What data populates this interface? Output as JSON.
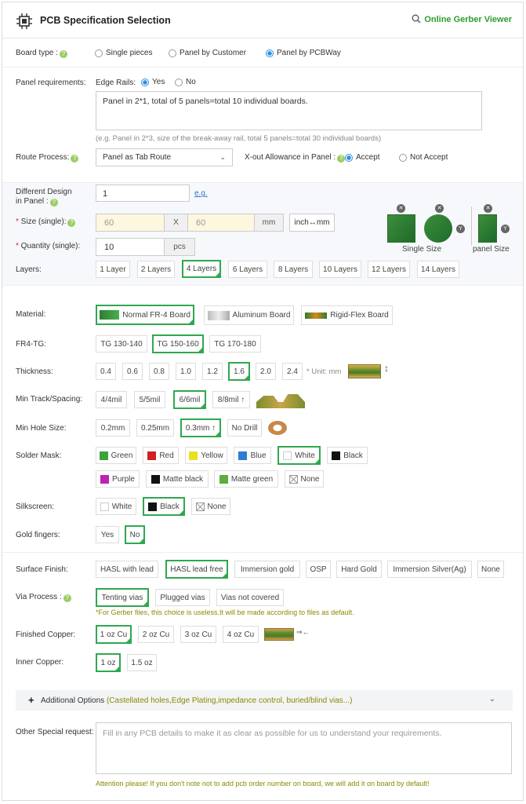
{
  "header": {
    "title": "PCB Specification Selection",
    "gerber_link": "Online Gerber Viewer"
  },
  "board_type": {
    "label": "Board type :",
    "options": [
      "Single pieces",
      "Panel by Customer",
      "Panel by PCBWay"
    ],
    "selected": "Panel by PCBWay"
  },
  "panel": {
    "label": "Panel requirements:",
    "edge_rails_label": "Edge Rails:",
    "edge_yes": "Yes",
    "edge_no": "No",
    "edge_selected": "Yes",
    "text": "Panel in 2*1, total of 5 panels=total 10 individual boards.",
    "hint": "(e.g. Panel in 2*3, size of the break-away rail, total 5 panels=total 30 individual boards)"
  },
  "route": {
    "label": "Route Process:",
    "value": "Panel as Tab Route",
    "xout_label": "X-out Allowance in Panel :",
    "accept": "Accept",
    "not_accept": "Not Accept",
    "selected": "Accept"
  },
  "different_design": {
    "label1": "Different Design",
    "label2": "in Panel :",
    "value": "1",
    "eg": "e.g."
  },
  "size": {
    "label": "Size (single):",
    "w_placeholder": "60",
    "x": "X",
    "h_placeholder": "60",
    "unit": "mm",
    "convert": "inch↔mm",
    "single_caption": "Single Size",
    "panel_caption": "panel Size"
  },
  "quantity": {
    "label": "Quantity (single):",
    "value": "10",
    "unit": "pcs"
  },
  "layers": {
    "label": "Layers:",
    "options": [
      "1 Layer",
      "2 Layers",
      "4 Layers",
      "6 Layers",
      "8 Layers",
      "10 Layers",
      "12 Layers",
      "14 Layers"
    ],
    "selected": "4 Layers"
  },
  "material": {
    "label": "Material:",
    "options": [
      "Normal FR-4 Board",
      "Aluminum Board",
      "Rigid-Flex Board"
    ],
    "selected": "Normal FR-4 Board"
  },
  "fr4tg": {
    "label": "FR4-TG:",
    "options": [
      "TG 130-140",
      "TG 150-160",
      "TG 170-180"
    ],
    "selected": "TG 150-160"
  },
  "thickness": {
    "label": "Thickness:",
    "options": [
      "0.4",
      "0.6",
      "0.8",
      "1.0",
      "1.2",
      "1.6",
      "2.0",
      "2.4"
    ],
    "selected": "1.6",
    "unit": "* Unit: mm"
  },
  "track": {
    "label": "Min Track/Spacing:",
    "options": [
      "4/4mil",
      "5/5mil",
      "6/6mil",
      "8/8mil ↑"
    ],
    "selected": "6/6mil"
  },
  "hole": {
    "label": "Min Hole Size:",
    "options": [
      "0.2mm",
      "0.25mm",
      "0.3mm ↑",
      "No Drill"
    ],
    "selected": "0.3mm ↑"
  },
  "solder_mask": {
    "label": "Solder Mask:",
    "options": [
      {
        "name": "Green",
        "color": "#3aa43a"
      },
      {
        "name": "Red",
        "color": "#d02020"
      },
      {
        "name": "Yellow",
        "color": "#e8e020"
      },
      {
        "name": "Blue",
        "color": "#2a7fd4"
      },
      {
        "name": "White",
        "color": "#ffffff"
      },
      {
        "name": "Black",
        "color": "#111111"
      },
      {
        "name": "Purple",
        "color": "#c020b0"
      },
      {
        "name": "Matte black",
        "color": "#111111"
      },
      {
        "name": "Matte green",
        "color": "#5cae3a"
      },
      {
        "name": "None",
        "color": "none"
      }
    ],
    "selected": "White"
  },
  "silkscreen": {
    "label": "Silkscreen:",
    "options": [
      "White",
      "Black",
      "None"
    ],
    "selected": "Black"
  },
  "gold": {
    "label": "Gold fingers:",
    "options": [
      "Yes",
      "No"
    ],
    "selected": "No"
  },
  "finish": {
    "label": "Surface Finish:",
    "options": [
      "HASL with lead",
      "HASL lead free",
      "Immersion gold",
      "OSP",
      "Hard Gold",
      "Immersion Silver(Ag)",
      "None"
    ],
    "selected": "HASL lead free"
  },
  "via": {
    "label": "Via Process :",
    "options": [
      "Tenting vias",
      "Plugged vias",
      "Vias not covered"
    ],
    "selected": "Tenting vias",
    "note": "*For Gerber files, this choice is useless.It will be made according to files as default."
  },
  "copper": {
    "label": "Finished Copper:",
    "options": [
      "1 oz Cu",
      "2 oz Cu",
      "3 oz Cu",
      "4 oz Cu"
    ],
    "selected": "1 oz Cu"
  },
  "inner": {
    "label": "Inner Copper:",
    "options": [
      "1 oz",
      "1.5 oz"
    ],
    "selected": "1 oz"
  },
  "additional": {
    "plus": "+",
    "title": "Additional Options",
    "detail": "(Castellated holes,Edge Plating,impedance control, buried/blind vias...)"
  },
  "special": {
    "label": "Other Special request:",
    "placeholder": "Fill in any PCB details to make it as clear as possible for us to understand your requirements.",
    "attention": "Attention please! If you don't note not to add pcb order number on board, we will add it on board by default!"
  }
}
